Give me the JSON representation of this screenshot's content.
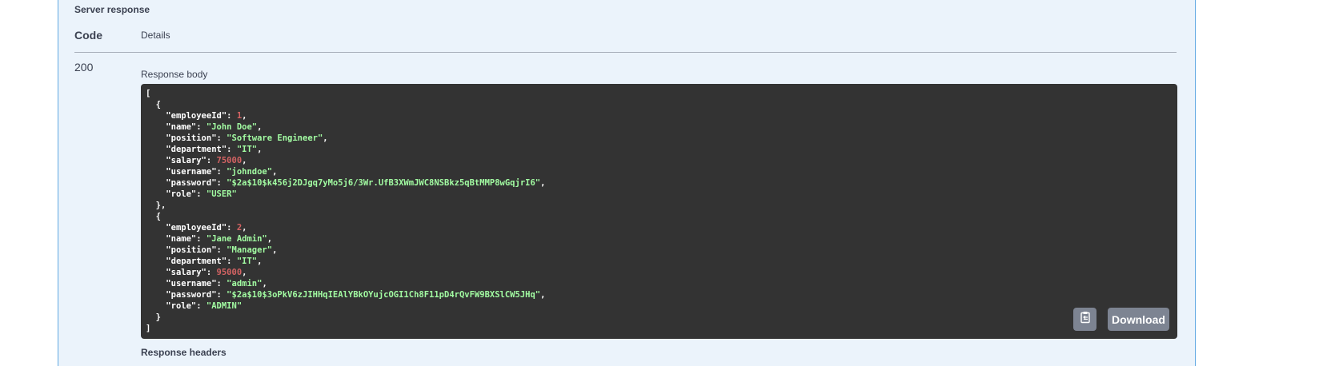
{
  "section": {
    "title": "Server response"
  },
  "table": {
    "code_header": "Code",
    "details_header": "Details",
    "code_value": "200"
  },
  "response_body": {
    "label": "Response body",
    "employees": [
      {
        "employeeId": "1",
        "name": "\"John Doe\"",
        "position": "\"Software Engineer\"",
        "department": "\"IT\"",
        "salary": "75000",
        "username": "\"johndoe\"",
        "password": "\"$2a$10$k456j2DJgq7yMo5j6/3Wr.UfB3XWmJWC8NSBkz5qBtMMP8wGqjrI6\"",
        "role": "\"USER\""
      },
      {
        "employeeId": "2",
        "name": "\"Jane Admin\"",
        "position": "\"Manager\"",
        "department": "\"IT\"",
        "salary": "95000",
        "username": "\"admin\"",
        "password": "\"$2a$10$3oPkV6zJIHHqIEAlYBkOYujcOGI1Ch8F11pD4rQvFW9BXSlCW5JHq\"",
        "role": "\"ADMIN\""
      }
    ],
    "keys": {
      "employeeId": "\"employeeId\"",
      "name": "\"name\"",
      "position": "\"position\"",
      "department": "\"department\"",
      "salary": "\"salary\"",
      "username": "\"username\"",
      "password": "\"password\"",
      "role": "\"role\""
    }
  },
  "buttons": {
    "copy_icon": "clipboard-icon",
    "download_label": "Download"
  },
  "response_headers": {
    "label": "Response headers"
  },
  "colors": {
    "panel_bg": "#ebf3fb",
    "panel_border": "#62a9e3",
    "code_bg": "#333333",
    "string_color": "#a2fca2",
    "number_color": "#d36363",
    "button_bg": "#7d8492"
  }
}
